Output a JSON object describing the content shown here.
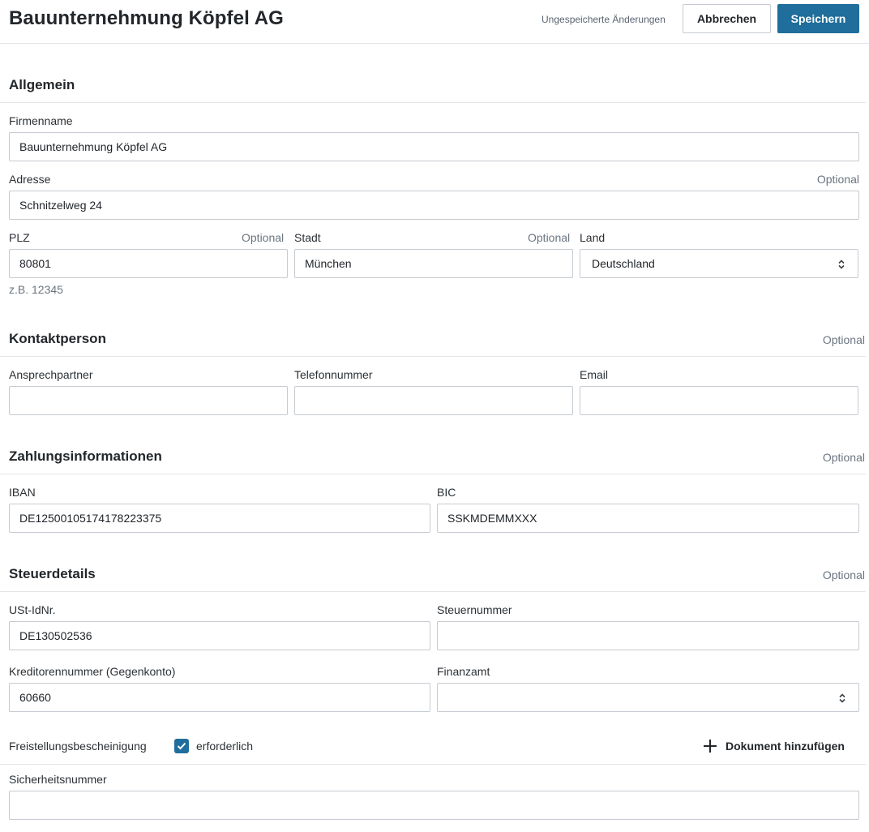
{
  "header": {
    "title": "Bauunternehmung Köpfel AG",
    "unsaved_text": "Ungespeicherte Änderungen",
    "cancel_label": "Abbrechen",
    "save_label": "Speichern"
  },
  "optional_label": "Optional",
  "general": {
    "title": "Allgemein",
    "company_name": {
      "label": "Firmenname",
      "value": "Bauunternehmung Köpfel AG"
    },
    "address": {
      "label": "Adresse",
      "value": "Schnitzelweg 24",
      "optional": "Optional"
    },
    "zip": {
      "label": "PLZ",
      "value": "80801",
      "optional": "Optional",
      "hint": "z.B. 12345"
    },
    "city": {
      "label": "Stadt",
      "value": "München",
      "optional": "Optional"
    },
    "country": {
      "label": "Land",
      "value": "Deutschland"
    }
  },
  "contact": {
    "title": "Kontaktperson",
    "optional": "Optional",
    "person": {
      "label": "Ansprechpartner",
      "value": ""
    },
    "phone": {
      "label": "Telefonnummer",
      "value": ""
    },
    "email": {
      "label": "Email",
      "value": ""
    }
  },
  "payment": {
    "title": "Zahlungsinformationen",
    "optional": "Optional",
    "iban": {
      "label": "IBAN",
      "value": "DE12500105174178223375"
    },
    "bic": {
      "label": "BIC",
      "value": "SSKMDEMMXXX"
    }
  },
  "tax": {
    "title": "Steuerdetails",
    "optional": "Optional",
    "vat_id": {
      "label": "USt-IdNr.",
      "value": "DE130502536"
    },
    "tax_number": {
      "label": "Steuernummer",
      "value": ""
    },
    "creditor_number": {
      "label": "Kreditorennummer (Gegenkonto)",
      "value": "60660"
    },
    "tax_office": {
      "label": "Finanzamt",
      "value": ""
    },
    "exemption": {
      "label": "Freistellungsbescheinigung",
      "checkbox_label": "erforderlich",
      "checked": true,
      "add_document_label": "Dokument hinzufügen"
    },
    "security_number": {
      "label": "Sicherheitsnummer",
      "value": ""
    }
  },
  "icons": {
    "checkbox": "checkmark-icon",
    "select": "sort-caret-icon",
    "add": "plus-icon"
  },
  "colors": {
    "primary": "#1f6e9b",
    "border": "#c6cbd1",
    "muted": "#6b7580"
  }
}
